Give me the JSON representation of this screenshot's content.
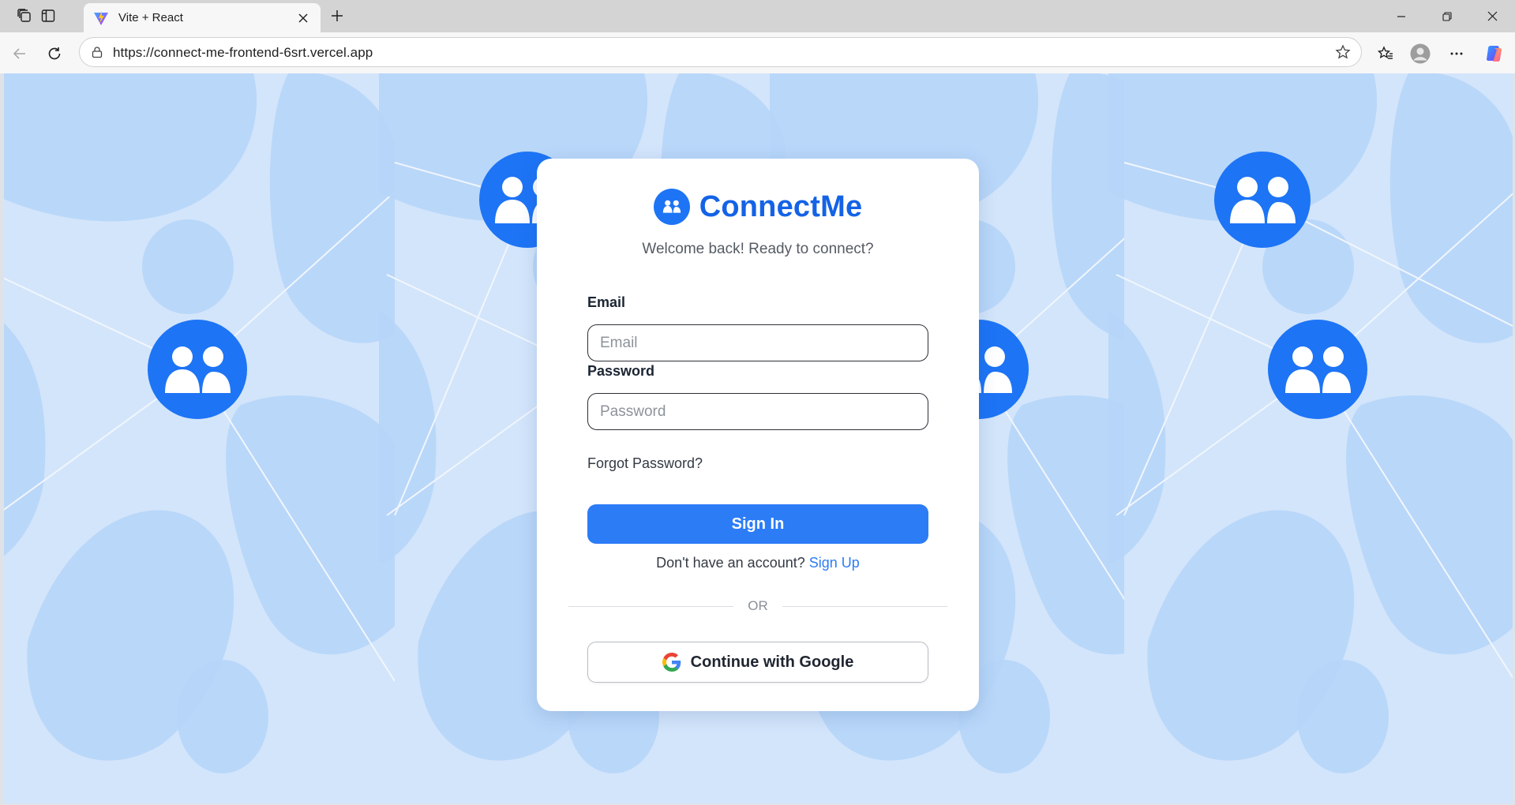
{
  "browser": {
    "tab_title": "Vite + React",
    "url": "https://connect-me-frontend-6srt.vercel.app"
  },
  "app": {
    "brand_name": "ConnectMe",
    "subtitle": "Welcome back! Ready to connect?",
    "email": {
      "label": "Email",
      "placeholder": "Email",
      "value": ""
    },
    "password": {
      "label": "Password",
      "placeholder": "Password",
      "value": ""
    },
    "forgot_label": "Forgot Password?",
    "signin_label": "Sign In",
    "signup_prompt": "Don't have an account?",
    "signup_link": "Sign Up",
    "or_label": "OR",
    "google_label": "Continue with Google"
  },
  "colors": {
    "brand": "#1463e6",
    "primary_button": "#2c7cf6",
    "avatar_circle": "#1d74f5",
    "background_light": "#d3e5fb",
    "background_blob": "#b4d4f8"
  }
}
